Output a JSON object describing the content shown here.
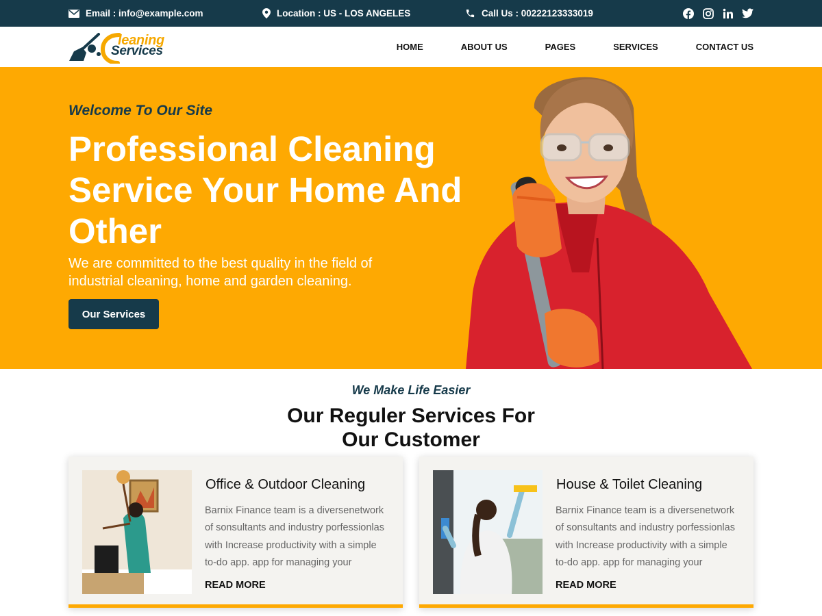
{
  "topbar": {
    "email": "Email : info@example.com",
    "location": "Location : US - LOS ANGELES",
    "call": "Call Us : 00222123333019",
    "social": [
      "facebook-icon",
      "instagram-icon",
      "linkedin-icon",
      "twitter-icon"
    ]
  },
  "logo": {
    "line1": "leaning",
    "line2": "Services"
  },
  "nav": {
    "items": [
      "HOME",
      "ABOUT US",
      "PAGES",
      "SERVICES",
      "CONTACT US"
    ]
  },
  "hero": {
    "welcome": "Welcome To Our Site",
    "title": "Professional Cleaning Service Your Home And Other",
    "subtitle": "We are committed to the best quality in the field of industrial cleaning, home and garden cleaning.",
    "button": "Our Services"
  },
  "services": {
    "tagline": "We Make Life Easier",
    "title": "Our Reguler Services For Our Customer",
    "cards": [
      {
        "title": "Office & Outdoor Cleaning",
        "description": "Barnix Finance team is a diversenetwork of sonsultants and industry porfessionlas with Increase productivity with a simple to-do app. app for managing your",
        "link": "READ MORE"
      },
      {
        "title": "House & Toilet Cleaning",
        "description": "Barnix Finance team is a diversenetwork of sonsultants and industry porfessionlas with Increase productivity with a simple to-do app. app for managing your",
        "link": "READ MORE"
      }
    ]
  },
  "colors": {
    "primary": "#163a4a",
    "accent": "#fea902",
    "hero_text": "#ffffff",
    "card_bg": "#f4f3f0"
  }
}
